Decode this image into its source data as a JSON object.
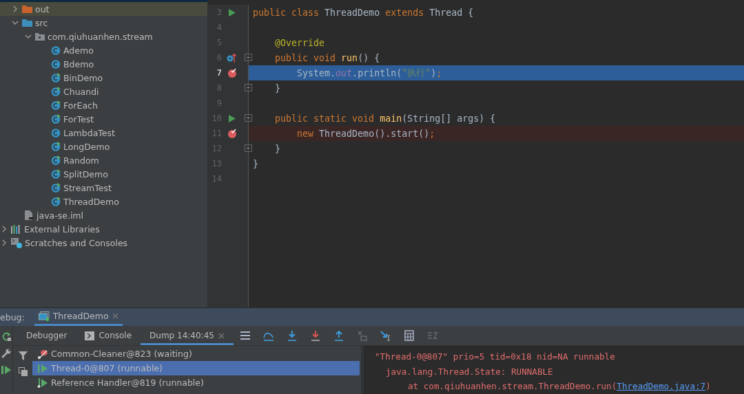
{
  "project_tree": {
    "items": [
      {
        "kind": "folder_excluded",
        "label": "out",
        "expanded": false,
        "selected": true
      },
      {
        "kind": "folder_source",
        "label": "src",
        "expanded": true,
        "selected": false,
        "children": [
          {
            "kind": "package",
            "label": "com.qiuhuanhen.stream",
            "expanded": true,
            "selected": false,
            "children": [
              {
                "kind": "class",
                "label": "Ademo",
                "runnable": false,
                "selected": false
              },
              {
                "kind": "class",
                "label": "Bdemo",
                "runnable": false,
                "selected": false
              },
              {
                "kind": "class",
                "label": "BinDemo",
                "runnable": true,
                "selected": false
              },
              {
                "kind": "class",
                "label": "Chuandi",
                "runnable": true,
                "selected": false
              },
              {
                "kind": "class",
                "label": "ForEach",
                "runnable": true,
                "selected": false
              },
              {
                "kind": "class",
                "label": "ForTest",
                "runnable": true,
                "selected": false
              },
              {
                "kind": "class",
                "label": "LambdaTest",
                "runnable": false,
                "selected": false
              },
              {
                "kind": "class",
                "label": "LongDemo",
                "runnable": true,
                "selected": false
              },
              {
                "kind": "class",
                "label": "Random",
                "runnable": true,
                "selected": false
              },
              {
                "kind": "class",
                "label": "SplitDemo",
                "runnable": true,
                "selected": false
              },
              {
                "kind": "class",
                "label": "StreamTest",
                "runnable": true,
                "selected": false
              },
              {
                "kind": "class",
                "label": "ThreadDemo",
                "runnable": true,
                "selected": false
              }
            ]
          }
        ]
      },
      {
        "kind": "file",
        "label": "java-se.iml",
        "selected": false
      },
      {
        "kind": "libraries",
        "label": "External Libraries",
        "expanded": false,
        "selected": false
      },
      {
        "kind": "scratches",
        "label": "Scratches and Consoles",
        "expanded": false,
        "selected": false
      }
    ]
  },
  "editor": {
    "lines": [
      {
        "number": "3",
        "run": true,
        "override": false,
        "breakpoint": false,
        "current": false,
        "fold": false,
        "tokens": [
          {
            "kind": "keyword",
            "text": "public class "
          },
          {
            "kind": "plain",
            "text": "ThreadDemo "
          },
          {
            "kind": "keyword",
            "text": "extends "
          },
          {
            "kind": "plain",
            "text": "Thread {"
          }
        ]
      },
      {
        "number": "4",
        "run": false,
        "override": false,
        "breakpoint": false,
        "current": false,
        "fold": false
      },
      {
        "number": "5",
        "run": false,
        "override": false,
        "breakpoint": false,
        "current": false,
        "fold": false,
        "tokens": [
          {
            "kind": "annotation",
            "text": "    @Override"
          }
        ]
      },
      {
        "number": "6",
        "run": false,
        "override": true,
        "breakpoint": false,
        "current": false,
        "fold": true,
        "tokens": [
          {
            "kind": "keyword",
            "text": "    public void "
          },
          {
            "kind": "method",
            "text": "run"
          },
          {
            "kind": "plain",
            "text": "() {"
          }
        ]
      },
      {
        "number": "7",
        "run": false,
        "override": false,
        "breakpoint": true,
        "current": true,
        "fold": false,
        "tokens": [
          {
            "kind": "plain",
            "text": "        System."
          },
          {
            "kind": "field",
            "text": "out"
          },
          {
            "kind": "plain",
            "text": ".println("
          },
          {
            "kind": "string",
            "text": "\"执行\""
          },
          {
            "kind": "plain",
            "text": ")"
          },
          {
            "kind": "keyword",
            "text": ";"
          }
        ]
      },
      {
        "number": "8",
        "run": false,
        "override": false,
        "breakpoint": false,
        "current": false,
        "fold": true,
        "tokens": [
          {
            "kind": "plain",
            "text": "    }"
          }
        ]
      },
      {
        "number": "9",
        "run": false,
        "override": false,
        "breakpoint": false,
        "current": false,
        "fold": false
      },
      {
        "number": "10",
        "run": true,
        "override": false,
        "breakpoint": false,
        "current": false,
        "fold": true,
        "tokens": [
          {
            "kind": "keyword",
            "text": "    public static void "
          },
          {
            "kind": "method",
            "text": "main"
          },
          {
            "kind": "plain",
            "text": "(String[] args) {"
          }
        ]
      },
      {
        "number": "11",
        "run": false,
        "override": false,
        "breakpoint": true,
        "current": false,
        "fold": false,
        "tokens": [
          {
            "kind": "keyword",
            "text": "        new "
          },
          {
            "kind": "plain",
            "text": "ThreadDemo().start()"
          },
          {
            "kind": "keyword",
            "text": ";"
          }
        ]
      },
      {
        "number": "12",
        "run": false,
        "override": false,
        "breakpoint": false,
        "current": false,
        "fold": true,
        "tokens": [
          {
            "kind": "plain",
            "text": "    }"
          }
        ]
      },
      {
        "number": "13",
        "run": false,
        "override": false,
        "breakpoint": false,
        "current": false,
        "fold": false,
        "tokens": [
          {
            "kind": "plain",
            "text": "}"
          }
        ]
      },
      {
        "number": "14",
        "run": false,
        "override": false,
        "breakpoint": false,
        "current": false,
        "fold": false
      }
    ]
  },
  "debug": {
    "label": "ebug:",
    "session_tab": {
      "label": "ThreadDemo",
      "selected": true
    },
    "tabs": [
      {
        "kind": "text",
        "label": "Debugger",
        "selected": false
      },
      {
        "kind": "console",
        "label": "Console",
        "selected": false
      },
      {
        "kind": "closable",
        "label": "Dump 14:40:45",
        "selected": true
      }
    ],
    "toolbar": [
      {
        "kind": "menu",
        "disabled": false
      },
      {
        "kind": "step_over",
        "disabled": false
      },
      {
        "kind": "step_into",
        "disabled": false
      },
      {
        "kind": "force_step_into",
        "disabled": false
      },
      {
        "kind": "step_out",
        "disabled": false
      },
      {
        "kind": "drop_frame",
        "disabled": true
      },
      {
        "kind": "run_to_cursor",
        "disabled": false
      },
      {
        "kind": "evaluate",
        "disabled": false
      },
      {
        "kind": "trace",
        "disabled": true
      }
    ],
    "threads": [
      {
        "kind": "waiting",
        "label": "Common-Cleaner@823 (waiting)",
        "selected": false
      },
      {
        "kind": "running",
        "label": "Thread-0@807 (runnable)",
        "selected": true
      },
      {
        "kind": "daemon",
        "label": "Reference Handler@819 (runnable)",
        "selected": false
      }
    ],
    "dump": [
      {
        "kind": "header",
        "text": "\"Thread-0@807\" prio=5 tid=0x18 nid=NA runnable"
      },
      {
        "kind": "state",
        "text": "java.lang.Thread.State: RUNNABLE"
      },
      {
        "kind": "frame",
        "text": "at com.qiuhuanhen.stream.ThreadDemo.run(",
        "link": "ThreadDemo.java:7",
        "suffix": ")"
      }
    ]
  }
}
